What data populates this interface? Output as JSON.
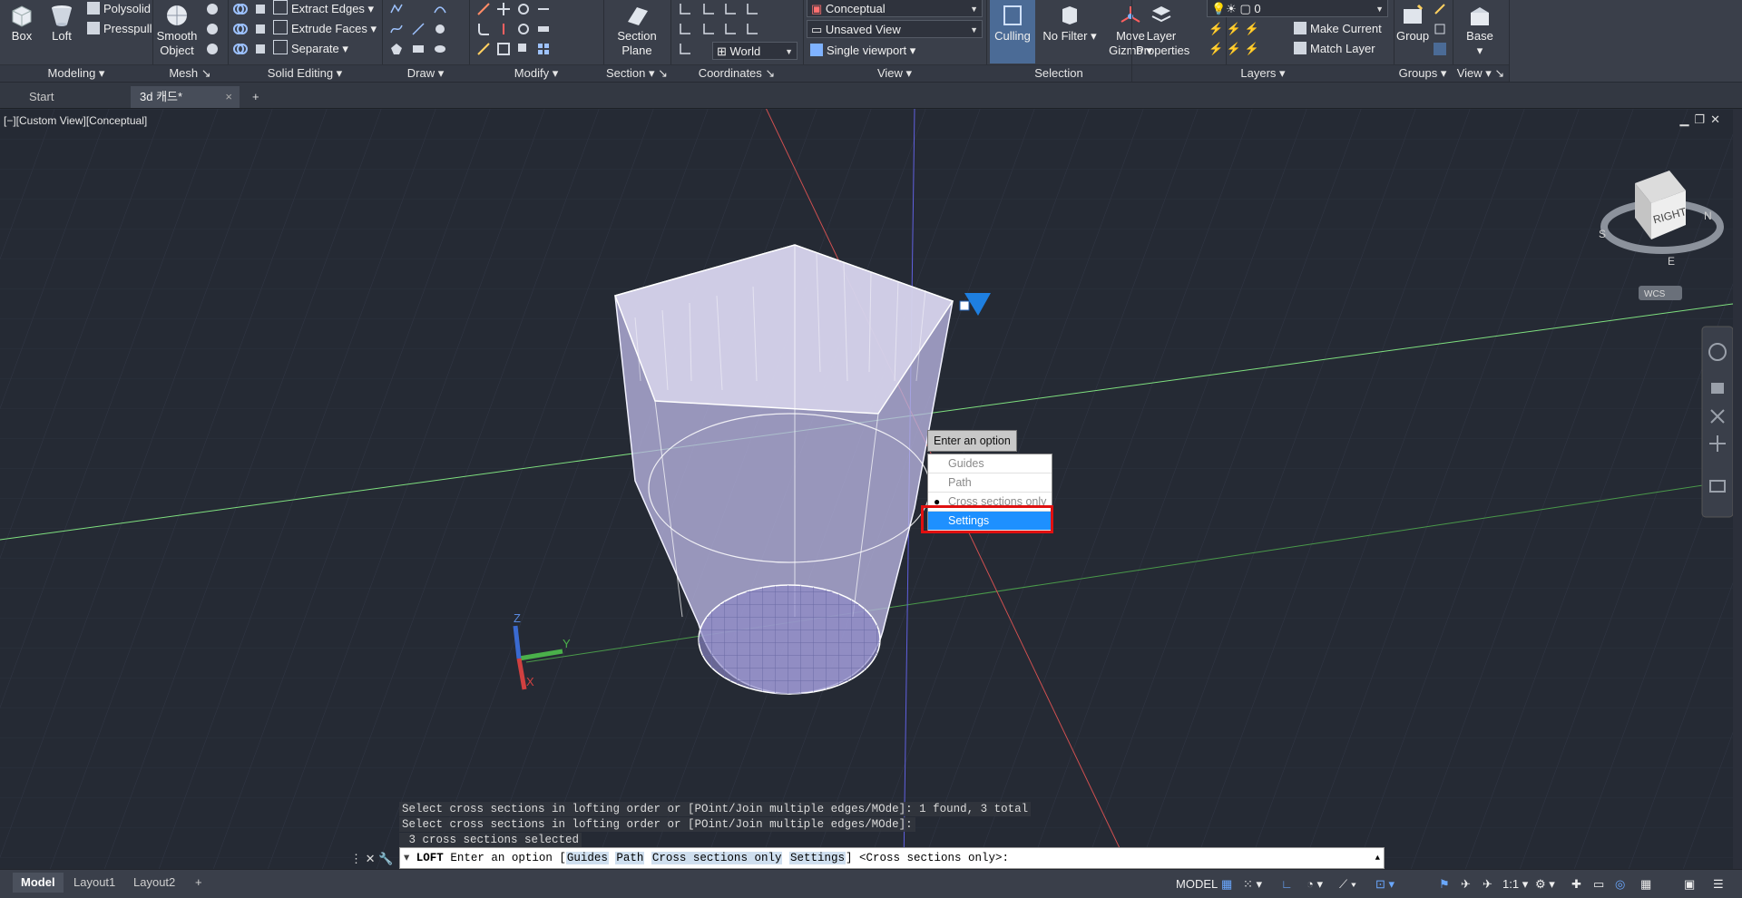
{
  "ribbon": {
    "modeling": {
      "title": "Modeling",
      "box": "Box",
      "loft": "Loft",
      "polysolid": "Polysolid",
      "presspull": "Presspull"
    },
    "mesh": {
      "title": "Mesh",
      "smooth_object_1": "Smooth",
      "smooth_object_2": "Object"
    },
    "solid_editing": {
      "title": "Solid Editing",
      "extract_edges": "Extract Edges",
      "extrude_faces": "Extrude Faces",
      "separate": "Separate"
    },
    "draw": {
      "title": "Draw"
    },
    "modify": {
      "title": "Modify"
    },
    "section": {
      "title": "Section",
      "section_plane_1": "Section",
      "section_plane_2": "Plane"
    },
    "coordinates": {
      "title": "Coordinates",
      "ucs_combo": "World"
    },
    "view": {
      "title": "View",
      "visual_style": "Conceptual",
      "named_view": "Unsaved View",
      "viewport": "Single viewport"
    },
    "selection": {
      "title": "Selection",
      "culling": "Culling",
      "no_filter": "No Filter",
      "move_gizmo_1": "Move",
      "move_gizmo_2": "Gizmo"
    },
    "layers": {
      "title": "Layers",
      "layer_properties_1": "Layer",
      "layer_properties_2": "Properties",
      "layer_combo": "0",
      "make_current": "Make Current",
      "match_layer": "Match Layer"
    },
    "groups": {
      "title": "Groups",
      "group": "Group"
    },
    "view2": {
      "title": "View",
      "base": "Base"
    }
  },
  "tabs": {
    "start": "Start",
    "doc": "3d 캐드*"
  },
  "viewport": {
    "label": "[−][Custom View][Conceptual]",
    "viewcube_face": "RIGHT",
    "wcs": "WCS",
    "compass": {
      "s": "S",
      "n": "N",
      "e": "E"
    },
    "ucs": {
      "x": "X",
      "y": "Y",
      "z": "Z"
    }
  },
  "context_menu": {
    "tooltip": "Enter an option",
    "items": [
      {
        "label": "Guides",
        "checked": false
      },
      {
        "label": "Path",
        "checked": false
      },
      {
        "label": "Cross sections only",
        "checked": true
      },
      {
        "label": "Settings",
        "selected": true
      }
    ]
  },
  "command": {
    "history": [
      "Select cross sections in lofting order or [POint/Join multiple edges/MOde]: 1 found, 3 total",
      "Select cross sections in lofting order or [POint/Join multiple edges/MOde]:",
      " 3 cross sections selected"
    ],
    "prompt_cmd": "LOFT",
    "prompt_text": "Enter an option [",
    "opt_guides": "Guides",
    "opt_path": "Path",
    "opt_cross": "Cross sections only",
    "opt_settings": "Settings",
    "prompt_tail": "] <Cross sections only>:"
  },
  "layout_tabs": [
    "Model",
    "Layout1",
    "Layout2"
  ],
  "status": {
    "model": "MODEL",
    "scale": "1:1"
  }
}
